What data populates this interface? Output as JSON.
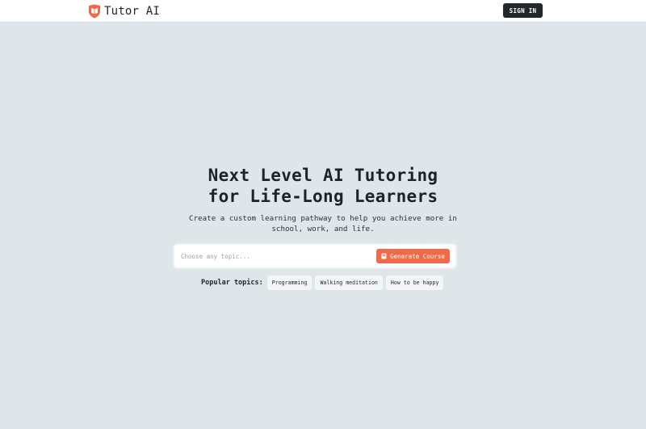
{
  "header": {
    "brand_name": "Tutor AI",
    "logo_icon": "shield-book-icon",
    "sign_in_label": "SIGN IN"
  },
  "hero": {
    "title_line1": "Next Level AI Tutoring",
    "title_line2": "for Life-Long Learners",
    "subtitle": "Create a custom learning pathway to help you achieve more in school, work, and life."
  },
  "search": {
    "placeholder": "Choose any topic...",
    "value": "",
    "button_label": "Generate Course",
    "button_icon": "book-icon"
  },
  "topics": {
    "label": "Popular topics:",
    "items": [
      "Programming",
      "Walking meditation",
      "How to be happy"
    ]
  },
  "colors": {
    "background": "#dfe6ea",
    "accent": "#ee6a4a",
    "dark_button": "#22272e"
  }
}
